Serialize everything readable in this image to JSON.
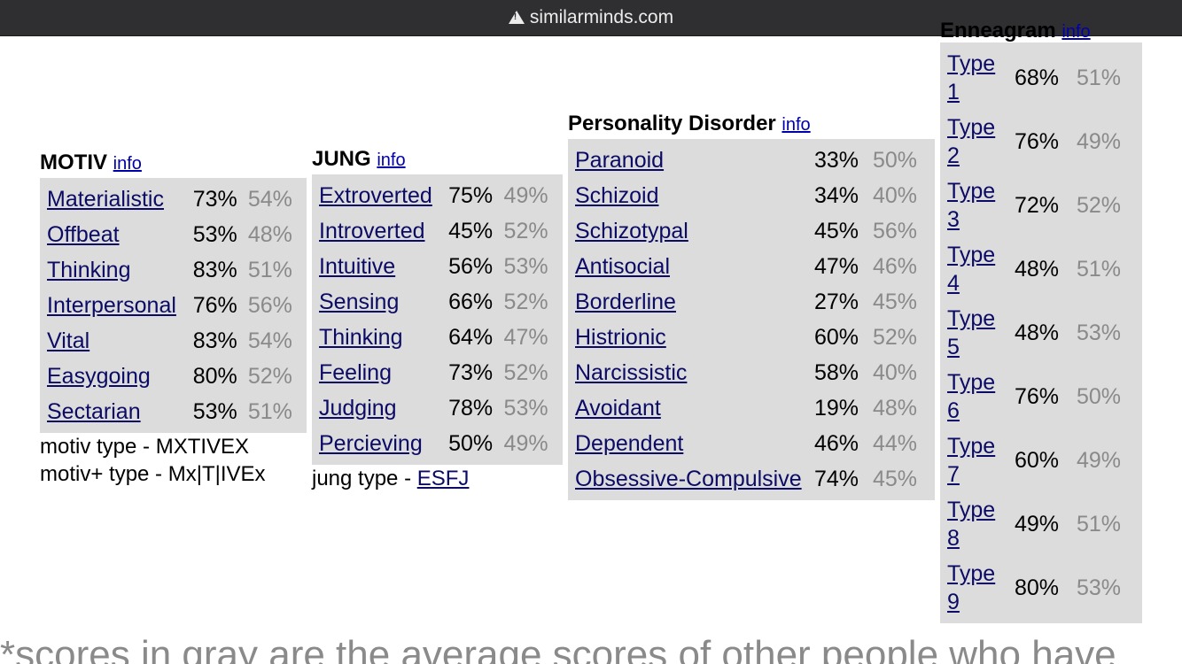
{
  "browser": {
    "url": "similarminds.com"
  },
  "motiv": {
    "title": "MOTIV",
    "info": "info",
    "rows": [
      {
        "name": "Materialistic",
        "pct": "73%",
        "avg": "54%"
      },
      {
        "name": "Offbeat",
        "pct": "53%",
        "avg": "48%"
      },
      {
        "name": "Thinking",
        "pct": "83%",
        "avg": "51%"
      },
      {
        "name": "Interpersonal",
        "pct": "76%",
        "avg": "56%"
      },
      {
        "name": "Vital",
        "pct": "83%",
        "avg": "54%"
      },
      {
        "name": "Easygoing",
        "pct": "80%",
        "avg": "52%"
      },
      {
        "name": "Sectarian",
        "pct": "53%",
        "avg": "51%"
      }
    ],
    "type_line": "motiv type - MXTIVEX",
    "type_plus_line": "motiv+ type - Mx|T|IVEx"
  },
  "jung": {
    "title": "JUNG",
    "info": "info",
    "rows": [
      {
        "name": "Extroverted",
        "pct": "75%",
        "avg": "49%"
      },
      {
        "name": "Introverted",
        "pct": "45%",
        "avg": "52%"
      },
      {
        "name": "Intuitive",
        "pct": "56%",
        "avg": "53%"
      },
      {
        "name": "Sensing",
        "pct": "66%",
        "avg": "52%"
      },
      {
        "name": "Thinking",
        "pct": "64%",
        "avg": "47%"
      },
      {
        "name": "Feeling",
        "pct": "73%",
        "avg": "52%"
      },
      {
        "name": "Judging",
        "pct": "78%",
        "avg": "53%"
      },
      {
        "name": "Percieving",
        "pct": "50%",
        "avg": "49%"
      }
    ],
    "type_prefix": "jung type - ",
    "type_value": "ESFJ"
  },
  "personality_disorder": {
    "title": "Personality Disorder",
    "info": "info",
    "rows": [
      {
        "name": "Paranoid",
        "pct": "33%",
        "avg": "50%"
      },
      {
        "name": "Schizoid",
        "pct": "34%",
        "avg": "40%"
      },
      {
        "name": "Schizotypal",
        "pct": "45%",
        "avg": "56%"
      },
      {
        "name": "Antisocial",
        "pct": "47%",
        "avg": "46%"
      },
      {
        "name": "Borderline",
        "pct": "27%",
        "avg": "45%"
      },
      {
        "name": "Histrionic",
        "pct": "60%",
        "avg": "52%"
      },
      {
        "name": "Narcissistic",
        "pct": "58%",
        "avg": "40%"
      },
      {
        "name": "Avoidant",
        "pct": "19%",
        "avg": "48%"
      },
      {
        "name": "Dependent",
        "pct": "46%",
        "avg": "44%"
      },
      {
        "name": "Obsessive-Compulsive",
        "pct": "74%",
        "avg": "45%"
      }
    ]
  },
  "enneagram": {
    "title": "Enneagram",
    "info": "info",
    "rows": [
      {
        "name": "Type 1",
        "pct": "68%",
        "avg": "51%"
      },
      {
        "name": "Type 2",
        "pct": "76%",
        "avg": "49%"
      },
      {
        "name": "Type 3",
        "pct": "72%",
        "avg": "52%"
      },
      {
        "name": "Type 4",
        "pct": "48%",
        "avg": "51%"
      },
      {
        "name": "Type 5",
        "pct": "48%",
        "avg": "53%"
      },
      {
        "name": "Type 6",
        "pct": "76%",
        "avg": "50%"
      },
      {
        "name": "Type 7",
        "pct": "60%",
        "avg": "49%"
      },
      {
        "name": "Type 8",
        "pct": "49%",
        "avg": "51%"
      },
      {
        "name": "Type 9",
        "pct": "80%",
        "avg": "53%"
      }
    ]
  },
  "footnote": "*scores in gray are the average scores of other people who have"
}
